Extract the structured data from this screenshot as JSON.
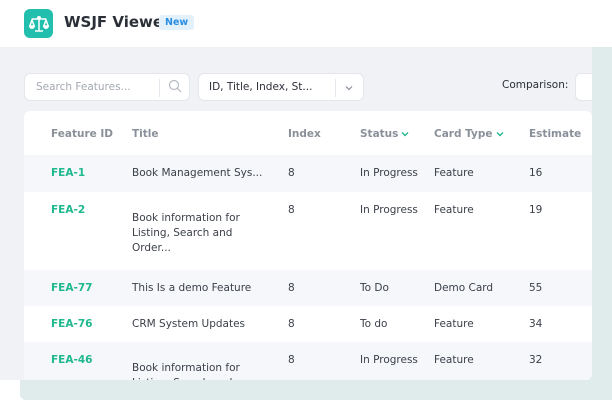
{
  "app": {
    "title": "WSJF Viewer",
    "badge": "New"
  },
  "toolbar": {
    "search_placeholder": "Search Features...",
    "columns_select": "ID, Title, Index, St...",
    "comparison_label": "Comparison:"
  },
  "table": {
    "headers": {
      "id": "Feature ID",
      "title": "Title",
      "index": "Index",
      "status": "Status",
      "card_type": "Card Type",
      "estimate": "Estimate"
    },
    "rows": [
      {
        "id": "FEA-1",
        "title": "Book Management Sys...",
        "index": "8",
        "status": "In Progress",
        "card_type": "Feature",
        "estimate": "16"
      },
      {
        "id": "FEA-2",
        "title": "Book information for Listing, Search and Order...",
        "index": "8",
        "status": "In Progress",
        "card_type": "Feature",
        "estimate": "19"
      },
      {
        "id": "FEA-77",
        "title": "This Is a demo Feature",
        "index": "8",
        "status": "To Do",
        "card_type": "Demo Card",
        "estimate": "55"
      },
      {
        "id": "FEA-76",
        "title": "CRM System Updates",
        "index": "8",
        "status": "To do",
        "card_type": "Feature",
        "estimate": "34"
      },
      {
        "id": "FEA-46",
        "title": "Book information for Listing, Search and Order...",
        "index": "8",
        "status": "In Progress",
        "card_type": "Feature",
        "estimate": "32"
      }
    ]
  },
  "colors": {
    "accent": "#22bfae",
    "id_link": "#1fb88f"
  }
}
